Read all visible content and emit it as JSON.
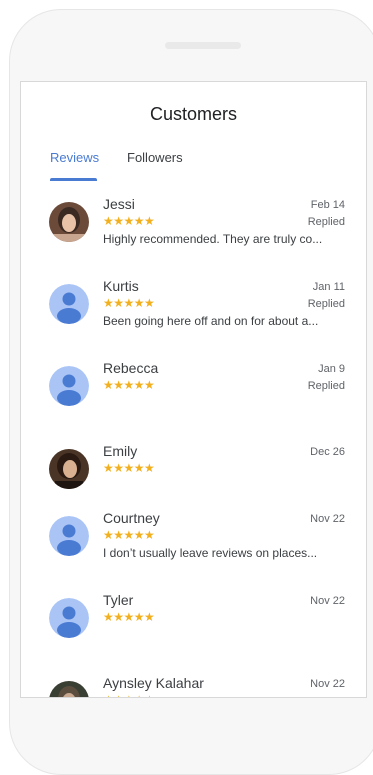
{
  "header": {
    "title": "Customers"
  },
  "tabs": [
    {
      "label": "Reviews",
      "active": true
    },
    {
      "label": "Followers",
      "active": false
    }
  ],
  "colors": {
    "accent": "#4a7bd3",
    "star": "#f2b01e",
    "avatar_bg": "#a9c4f5",
    "avatar_fg": "#4a7bd3"
  },
  "reviews": [
    {
      "name": "Jessi",
      "date": "Feb 14",
      "stars": "★★★★★",
      "status": "Replied",
      "snippet": "Highly recommended. They are truly co...",
      "avatar": "photo"
    },
    {
      "name": "Kurtis",
      "date": "Jan 11",
      "stars": "★★★★★",
      "status": "Replied",
      "snippet": "Been going here off and on for about a...",
      "avatar": "default-person-icon"
    },
    {
      "name": "Rebecca",
      "date": "Jan 9",
      "stars": "★★★★★",
      "status": "Replied",
      "snippet": "",
      "avatar": "default-person-icon"
    },
    {
      "name": "Emily",
      "date": "Dec 26",
      "stars": "★★★★★",
      "status": "",
      "snippet": "",
      "avatar": "photo"
    },
    {
      "name": "Courtney",
      "date": "Nov 22",
      "stars": "★★★★★",
      "status": "",
      "snippet": "I don’t usually leave reviews on places...",
      "avatar": "default-person-icon"
    },
    {
      "name": "Tyler",
      "date": "Nov 22",
      "stars": "★★★★★",
      "status": "",
      "snippet": "",
      "avatar": "default-person-icon"
    },
    {
      "name": "Aynsley Kalahar",
      "date": "Nov 22",
      "stars": "★★★★★",
      "status": "",
      "snippet": "",
      "avatar": "photo"
    }
  ]
}
